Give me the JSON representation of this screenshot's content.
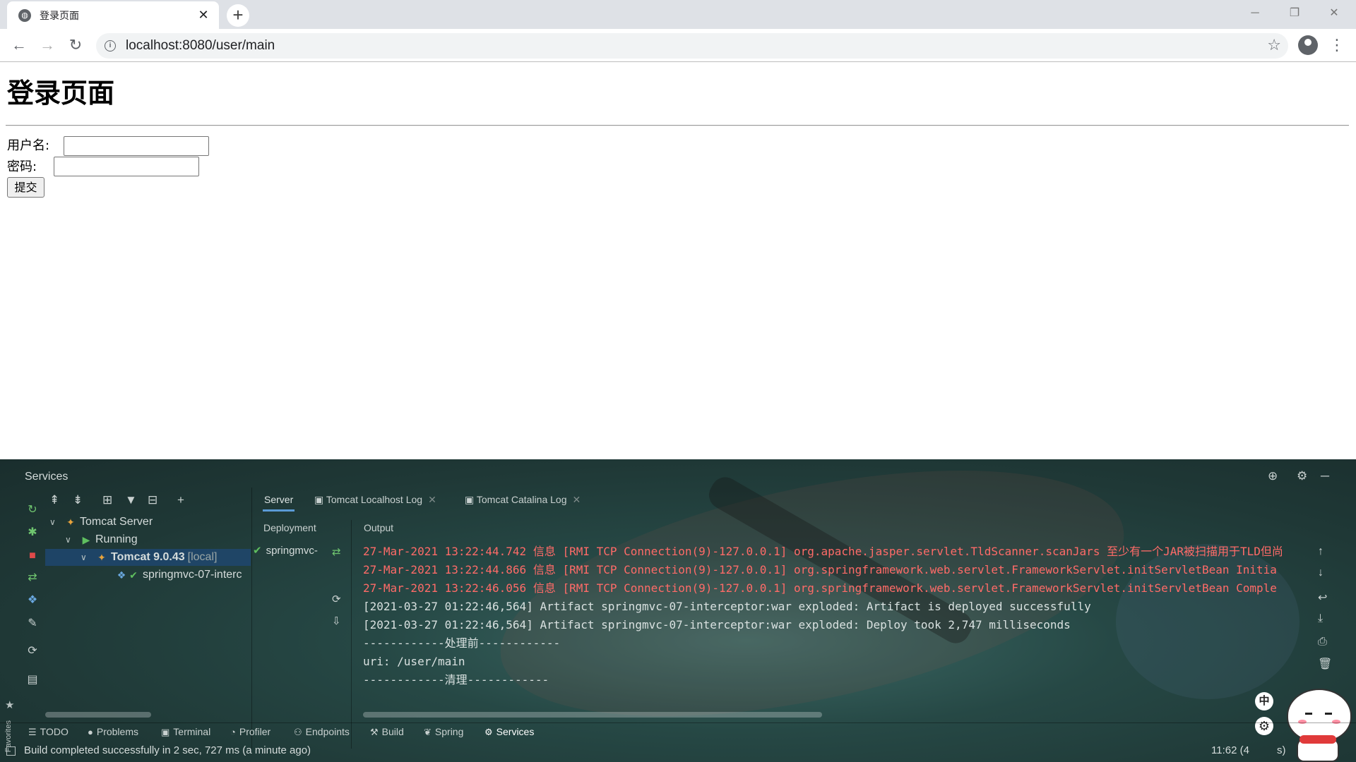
{
  "browser": {
    "tab_title": "登录页面",
    "tab_close": "✕",
    "new_tab": "+",
    "url": "localhost:8080/user/main",
    "window_controls": {
      "minimize": "─",
      "restore": "❐",
      "close": "✕"
    },
    "nav": {
      "back": "←",
      "forward": "→",
      "reload": "↻"
    },
    "star": "☆",
    "menu": "⋮"
  },
  "page": {
    "heading": "登录页面",
    "username_label": "用户名:",
    "password_label": "密码:",
    "submit_label": "提交"
  },
  "ide": {
    "title": "Services",
    "tree": {
      "server": "Tomcat Server",
      "running": "Running",
      "instance": "Tomcat 9.0.43",
      "instance_suffix": "[local]",
      "artifact": "springmvc-07-interc"
    },
    "tabs": [
      {
        "label": "Server"
      },
      {
        "label": "Tomcat Localhost Log"
      },
      {
        "label": "Tomcat Catalina Log"
      }
    ],
    "columns": {
      "deployment": "Deployment",
      "output": "Output"
    },
    "deployment_item": "springmvc-",
    "output_lines": [
      {
        "kind": "err",
        "text": "27-Mar-2021 13:22:44.742 信息 [RMI TCP Connection(9)-127.0.0.1] org.apache.jasper.servlet.TldScanner.scanJars 至少有一个JAR被扫描用于TLD但尚"
      },
      {
        "kind": "err",
        "text": "27-Mar-2021 13:22:44.866 信息 [RMI TCP Connection(9)-127.0.0.1] org.springframework.web.servlet.FrameworkServlet.initServletBean Initia"
      },
      {
        "kind": "err",
        "text": "27-Mar-2021 13:22:46.056 信息 [RMI TCP Connection(9)-127.0.0.1] org.springframework.web.servlet.FrameworkServlet.initServletBean Comple"
      },
      {
        "kind": "info",
        "text": "[2021-03-27 01:22:46,564] Artifact springmvc-07-interceptor:war exploded: Artifact is deployed successfully"
      },
      {
        "kind": "info",
        "text": "[2021-03-27 01:22:46,564] Artifact springmvc-07-interceptor:war exploded: Deploy took 2,747 milliseconds"
      },
      {
        "kind": "info",
        "text": "------------处理前------------"
      },
      {
        "kind": "info",
        "text": "uri: /user/main"
      },
      {
        "kind": "info",
        "text": "------------清理------------"
      }
    ],
    "bottom_tabs": [
      {
        "label": "TODO",
        "icon": "☰"
      },
      {
        "label": "Problems",
        "icon": "●"
      },
      {
        "label": "Terminal",
        "icon": "▣"
      },
      {
        "label": "Profiler",
        "icon": "◔"
      },
      {
        "label": "Endpoints",
        "icon": "⚇"
      },
      {
        "label": "Build",
        "icon": "⚒"
      },
      {
        "label": "Spring",
        "icon": "❦"
      },
      {
        "label": "Services",
        "icon": "⚙"
      }
    ],
    "favorites_label": "Favorites",
    "ime_label": "中",
    "status_message": "Build completed successfully in 2 sec, 727 ms (a minute ago)",
    "status_position": "11:62 (4",
    "status_position_tail": "s)"
  },
  "colors": {
    "error_text": "#ff6b68",
    "success": "#5fbf5f",
    "selection": "#1e466e",
    "tab_underline": "#5a9ad6"
  }
}
